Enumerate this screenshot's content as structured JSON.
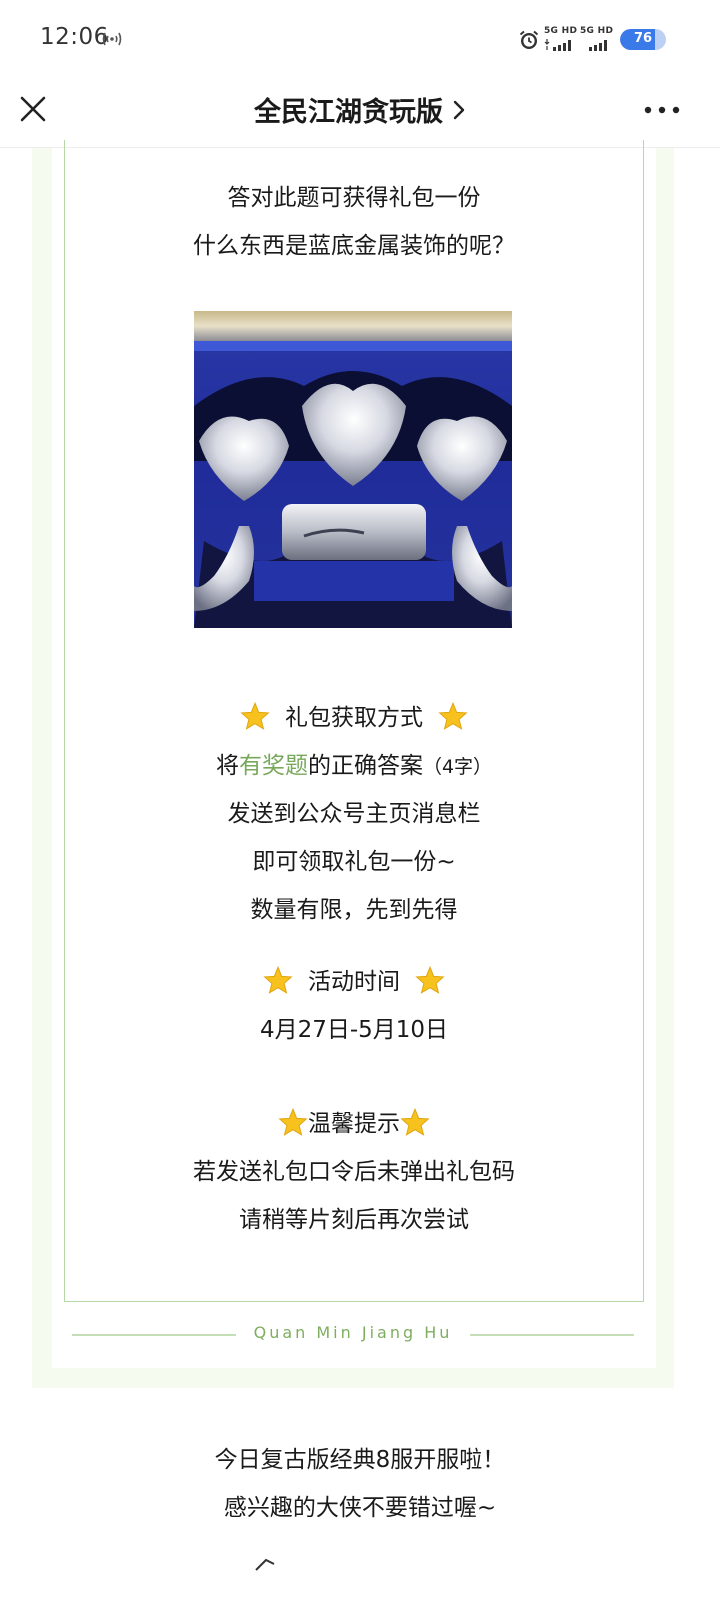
{
  "status_bar": {
    "time": "12:06",
    "network_1": "5G HD",
    "network_2": "5G HD",
    "battery": "76",
    "battery_level": 0.76,
    "icons": [
      "hotspot-icon",
      "alarm-icon",
      "signal-icon",
      "battery-icon"
    ]
  },
  "header": {
    "title": "全民江湖贪玩版",
    "close_icon": "close-icon",
    "chevron_icon": "chevron-right-icon",
    "more_icon": "more-icon"
  },
  "quiz": {
    "line1": "答对此题可获得礼包一份",
    "line2": "什么东西是蓝底金属装饰的呢？"
  },
  "gift_method": {
    "heading": "礼包获取方式",
    "line1_prefix": "将",
    "line1_highlight": "有奖题",
    "line1_suffix": "的正确答案",
    "line1_note": "（4字）",
    "line2": "发送到公众号主页消息栏",
    "line3": "即可领取礼包一份~",
    "line4": "数量有限，先到先得"
  },
  "activity": {
    "heading": "活动时间",
    "dates": "4月27日-5月10日"
  },
  "tips": {
    "heading": "温馨提示",
    "line1": "若发送礼包口令后未弹出礼包码",
    "line2": "请稍等片刻后再次尝试"
  },
  "footer": {
    "brand": "Quan Min Jiang Hu"
  },
  "bottom": {
    "line1": "今日复古版经典8服开服啦！",
    "line2": "感兴趣的大侠不要错过喔~"
  },
  "colors": {
    "accent_green": "#78a85b",
    "frame_green": "#b6d7a8",
    "star_yellow": "#f7c21d",
    "battery_blue": "#3a7ae8"
  }
}
